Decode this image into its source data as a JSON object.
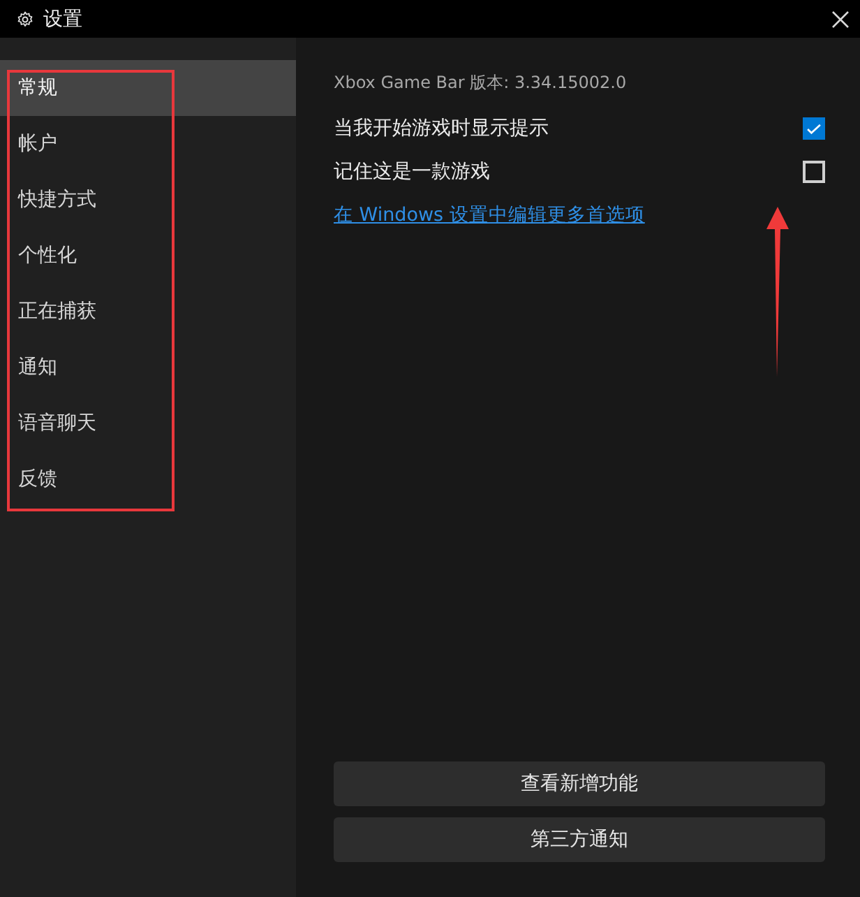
{
  "window": {
    "title": "设置"
  },
  "sidebar": {
    "items": [
      {
        "label": "常规",
        "selected": true
      },
      {
        "label": "帐户",
        "selected": false
      },
      {
        "label": "快捷方式",
        "selected": false
      },
      {
        "label": "个性化",
        "selected": false
      },
      {
        "label": "正在捕获",
        "selected": false
      },
      {
        "label": "通知",
        "selected": false
      },
      {
        "label": "语音聊天",
        "selected": false
      },
      {
        "label": "反馈",
        "selected": false
      }
    ]
  },
  "general": {
    "version": "Xbox Game Bar 版本: 3.34.15002.0",
    "options": [
      {
        "label": "当我开始游戏时显示提示",
        "checked": true
      },
      {
        "label": "记住这是一款游戏",
        "checked": false
      }
    ],
    "link": "在 Windows 设置中编辑更多首选项"
  },
  "buttons": [
    "查看新增功能",
    "第三方通知"
  ]
}
